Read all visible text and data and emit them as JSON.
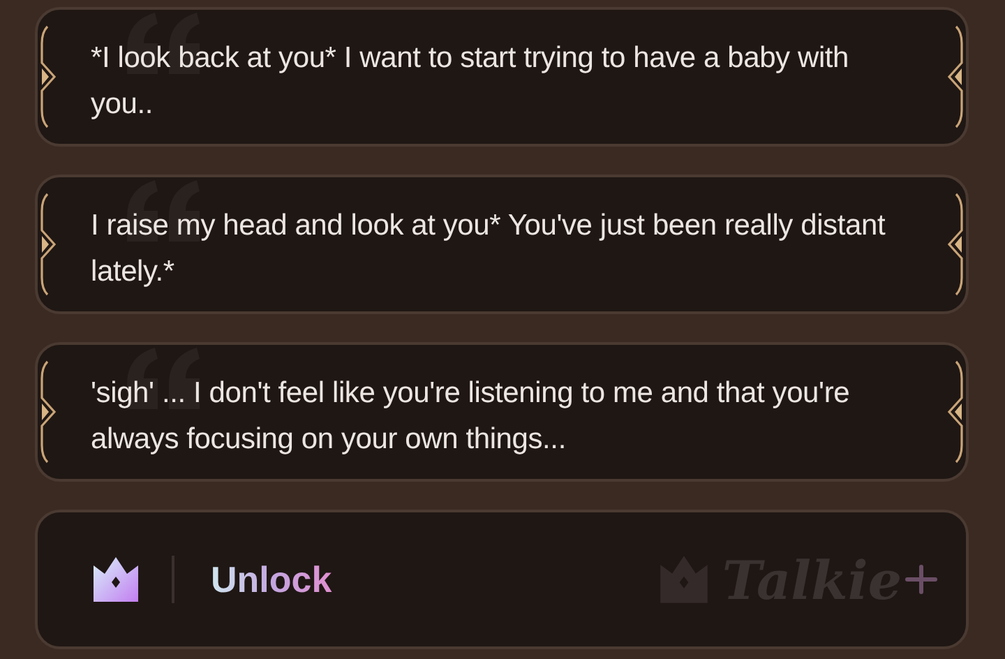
{
  "messages": [
    {
      "text": "*I look back at you* I want to start trying to have a baby with you.."
    },
    {
      "text": "I raise my head and look at you* You've just been really distant lately.*"
    },
    {
      "text": "'sigh' ... I don't feel like you're listening to me and that you're always focusing on your own things..."
    }
  ],
  "unlock": {
    "label": "Unlock",
    "brand": "Talkie"
  }
}
